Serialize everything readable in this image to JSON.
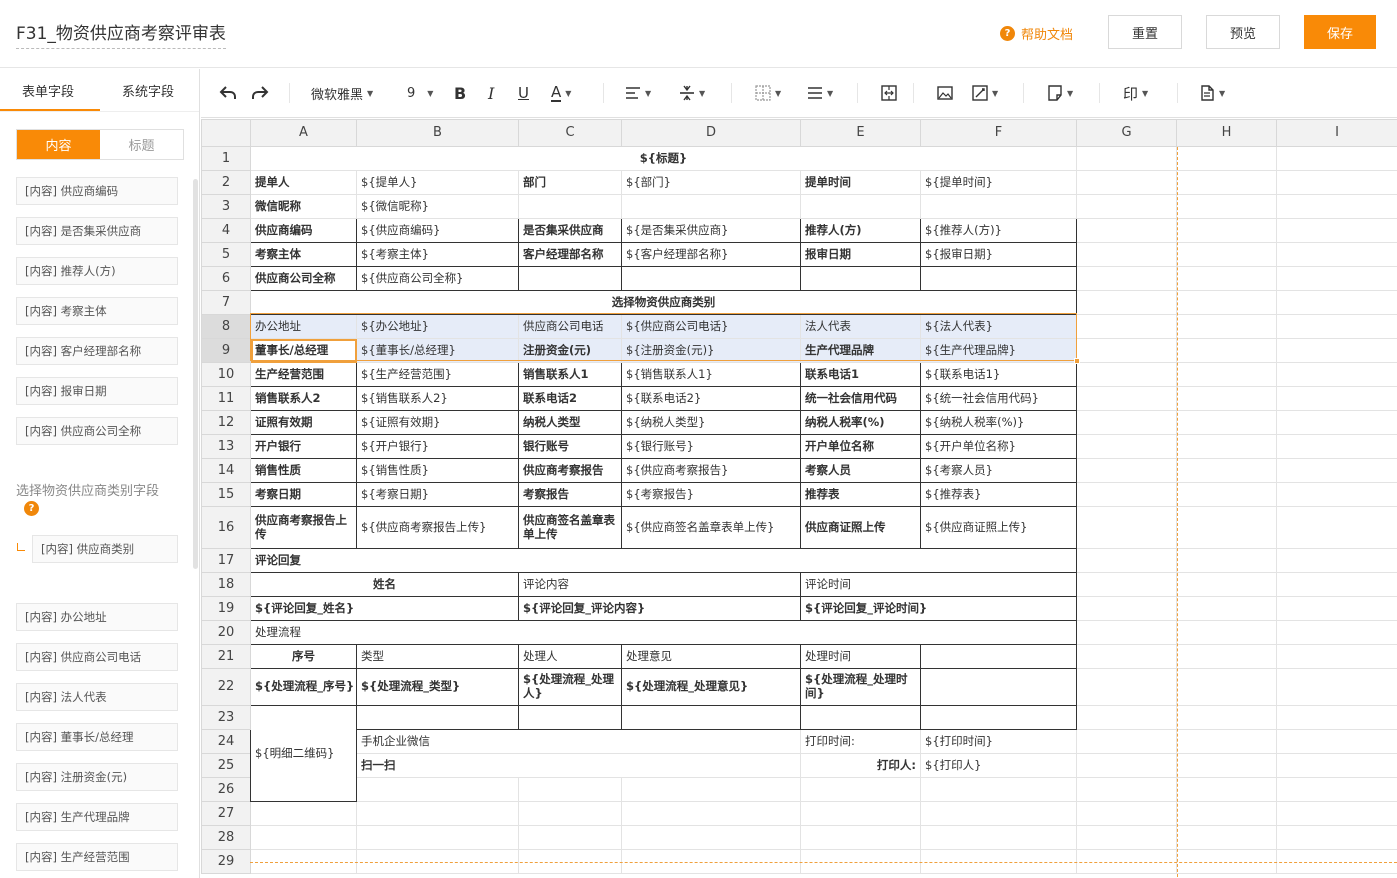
{
  "header": {
    "title": "F31_物资供应商考察评审表",
    "help_label": "帮助文档",
    "reset_label": "重置",
    "preview_label": "预览",
    "save_label": "保存"
  },
  "sidebar": {
    "tabs": [
      "表单字段",
      "系统字段"
    ],
    "segments": [
      "内容",
      "标题"
    ],
    "fields": [
      "[内容] 供应商编码",
      "[内容] 是否集采供应商",
      "[内容] 推荐人(方)",
      "[内容] 考察主体",
      "[内容] 客户经理部名称",
      "[内容] 报审日期",
      "[内容] 供应商公司全称"
    ],
    "category_label": "选择物资供应商类别字段",
    "category_field": "[内容] 供应商类别",
    "fields2": [
      "[内容] 办公地址",
      "[内容] 供应商公司电话",
      "[内容] 法人代表",
      "[内容] 董事长/总经理",
      "[内容] 注册资金(元)",
      "[内容] 生产代理品牌",
      "[内容] 生产经营范围"
    ]
  },
  "toolbar": {
    "font_family": "微软雅黑",
    "font_size": "9"
  },
  "grid": {
    "columns": [
      "A",
      "B",
      "C",
      "D",
      "E",
      "F",
      "G",
      "H",
      "I"
    ],
    "row_numbers": [
      "1",
      "2",
      "3",
      "4",
      "5",
      "6",
      "7",
      "8",
      "9",
      "10",
      "11",
      "12",
      "13",
      "14",
      "15",
      "16",
      "17",
      "18",
      "19",
      "20",
      "21",
      "22",
      "23",
      "24",
      "25",
      "26",
      "27",
      "28",
      "29"
    ],
    "r1": {
      "title": "${标题}"
    },
    "r2": {
      "a": "提单人",
      "b": "${提单人}",
      "c": "部门",
      "d": "${部门}",
      "e": "提单时间",
      "f": "${提单时间}"
    },
    "r3": {
      "a": "微信昵称",
      "b": "${微信昵称}"
    },
    "r4": {
      "a": "供应商编码",
      "b": "${供应商编码}",
      "c": "是否集采供应商",
      "d": "${是否集采供应商}",
      "e": "推荐人(方)",
      "f": "${推荐人(方)}"
    },
    "r5": {
      "a": "考察主体",
      "b": "${考察主体}",
      "c": "客户经理部名称",
      "d": "${客户经理部名称}",
      "e": "报审日期",
      "f": "${报审日期}"
    },
    "r6": {
      "a": "供应商公司全称",
      "b": "${供应商公司全称}"
    },
    "r7": {
      "title": "选择物资供应商类别"
    },
    "r8": {
      "a": "办公地址",
      "b": "${办公地址}",
      "c": "供应商公司电话",
      "d": "${供应商公司电话}",
      "e": "法人代表",
      "f": "${法人代表}"
    },
    "r9": {
      "a": "董事长/总经理",
      "b": "${董事长/总经理}",
      "c": "注册资金(元)",
      "d": "${注册资金(元)}",
      "e": "生产代理品牌",
      "f": "${生产代理品牌}"
    },
    "r10": {
      "a": "生产经营范围",
      "b": "${生产经营范围}",
      "c": "销售联系人1",
      "d": "${销售联系人1}",
      "e": "联系电话1",
      "f": "${联系电话1}"
    },
    "r11": {
      "a": "销售联系人2",
      "b": "${销售联系人2}",
      "c": "联系电话2",
      "d": "${联系电话2}",
      "e": "统一社会信用代码",
      "f": "${统一社会信用代码}"
    },
    "r12": {
      "a": "证照有效期",
      "b": "${证照有效期}",
      "c": "纳税人类型",
      "d": "${纳税人类型}",
      "e": "纳税人税率(%)",
      "f": "${纳税人税率(%)}"
    },
    "r13": {
      "a": "开户银行",
      "b": "${开户银行}",
      "c": "银行账号",
      "d": "${银行账号}",
      "e": "开户单位名称",
      "f": "${开户单位名称}"
    },
    "r14": {
      "a": "销售性质",
      "b": "${销售性质}",
      "c": "供应商考察报告",
      "d": "${供应商考察报告}",
      "e": "考察人员",
      "f": "${考察人员}"
    },
    "r15": {
      "a": "考察日期",
      "b": "${考察日期}",
      "c": "考察报告",
      "d": "${考察报告}",
      "e": "推荐表",
      "f": "${推荐表}"
    },
    "r16": {
      "a": "供应商考察报告上传",
      "b": "${供应商考察报告上传}",
      "c": "供应商签名盖章表单上传",
      "d": "${供应商签名盖章表单上传}",
      "e": "供应商证照上传",
      "f": "${供应商证照上传}"
    },
    "r17": {
      "a": "评论回复"
    },
    "r18": {
      "a": "姓名",
      "c": "评论内容",
      "e": "评论时间"
    },
    "r19": {
      "a": "${评论回复_姓名}",
      "c": "${评论回复_评论内容}",
      "e": "${评论回复_评论时间}"
    },
    "r20": {
      "a": "处理流程"
    },
    "r21": {
      "a": "序号",
      "b": "类型",
      "c": "处理人",
      "d": "处理意见",
      "e": "处理时间"
    },
    "r22": {
      "a": "${处理流程_序号}",
      "b": "${处理流程_类型}",
      "c": "${处理流程_处理人}",
      "d": "${处理流程_处理意见}",
      "e": "${处理流程_处理时间}"
    },
    "r24": {
      "a": "${明细二维码}",
      "b": "手机企业微信",
      "e": "打印时间:",
      "f": "${打印时间}"
    },
    "r25": {
      "b": "扫一扫",
      "e": "打印人:",
      "f": "${打印人}"
    }
  }
}
